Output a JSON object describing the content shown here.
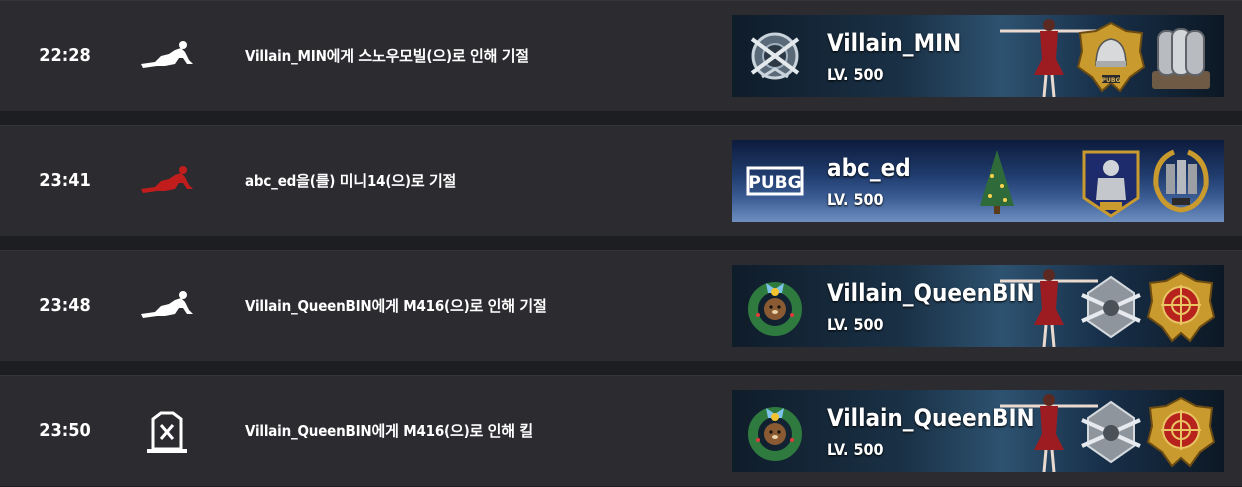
{
  "events": [
    {
      "time": "22:28",
      "status_icon": "knocked-down-icon",
      "message": "Villain_MIN에게 스노우모빌(으)로 인해 기절",
      "player": {
        "name": "Villain_MIN",
        "level": "LV. 500"
      }
    },
    {
      "time": "23:41",
      "status_icon": "knocked-down-red-icon",
      "message": "abc_ed을(를) 미니14(으)로 기절",
      "player": {
        "name": "abc_ed",
        "level": "LV. 500"
      }
    },
    {
      "time": "23:48",
      "status_icon": "knocked-down-icon",
      "message": "Villain_QueenBIN에게 M416(으)로 인해 기절",
      "player": {
        "name": "Villain_QueenBIN",
        "level": "LV. 500"
      }
    },
    {
      "time": "23:50",
      "status_icon": "killed-tombstone-icon",
      "message": "Villain_QueenBIN에게 M416(으)로 인해 킬",
      "player": {
        "name": "Villain_QueenBIN",
        "level": "LV. 500"
      }
    }
  ],
  "emblem_logo_text": "PUBG",
  "colors": {
    "row_bg": "#2b2b30",
    "page_bg": "#1d1e22",
    "self_knock_icon": "#c21d1d",
    "text": "#ffffff",
    "gold_badge": "#c99a2e"
  }
}
